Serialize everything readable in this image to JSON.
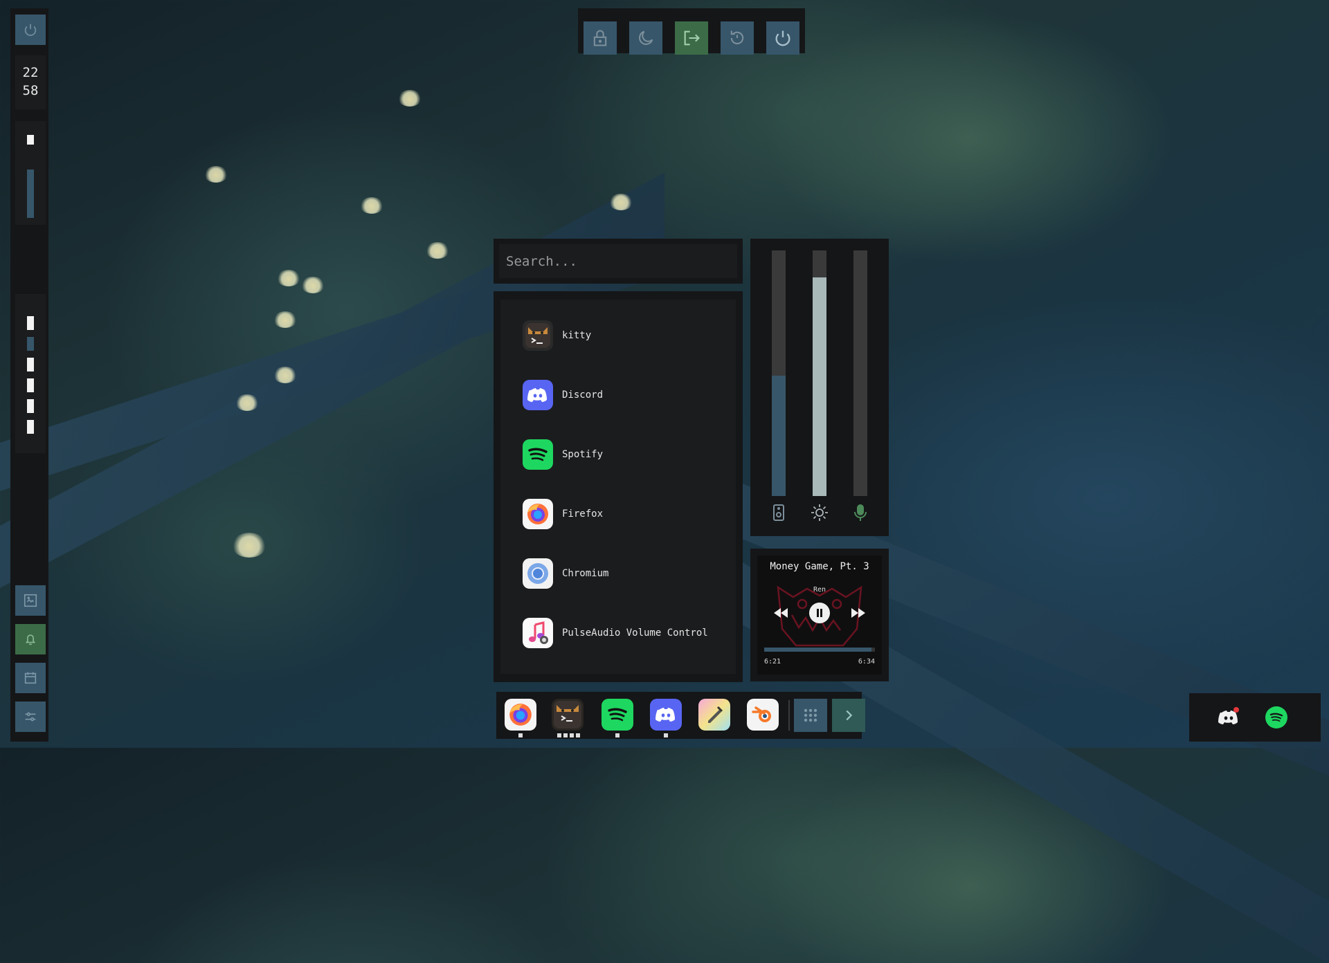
{
  "clock": {
    "hour": "22",
    "minute": "58"
  },
  "power_menu": {
    "items": [
      {
        "name": "lock",
        "icon": "lock-icon",
        "active": false
      },
      {
        "name": "suspend",
        "icon": "moon-icon",
        "active": false
      },
      {
        "name": "logout",
        "icon": "logout-icon",
        "active": true
      },
      {
        "name": "reboot",
        "icon": "reboot-icon",
        "active": false
      },
      {
        "name": "shutdown",
        "icon": "power-icon",
        "active": false
      }
    ]
  },
  "launcher": {
    "search_placeholder": "Search...",
    "apps": [
      {
        "label": "kitty",
        "icon": "kitty-icon"
      },
      {
        "label": "Discord",
        "icon": "discord-icon"
      },
      {
        "label": "Spotify",
        "icon": "spotify-icon"
      },
      {
        "label": "Firefox",
        "icon": "firefox-icon"
      },
      {
        "label": "Chromium",
        "icon": "chromium-icon"
      },
      {
        "label": "PulseAudio Volume Control",
        "icon": "pulseaudio-icon"
      }
    ]
  },
  "sliders": {
    "volume_level": 0.49,
    "brightness_level": 0.89,
    "mic_level": 0.0,
    "icons": [
      "speaker-icon",
      "sun-icon",
      "mic-icon"
    ]
  },
  "battery": {
    "level": 0.7
  },
  "media": {
    "title": "Money Game, Pt. 3",
    "artist": "Ren",
    "elapsed": "6:21",
    "total": "6:34",
    "progress": 0.97
  },
  "dock": {
    "apps": [
      {
        "name": "firefox",
        "running": true
      },
      {
        "name": "kitty",
        "running": true
      },
      {
        "name": "spotify",
        "running": true
      },
      {
        "name": "discord",
        "running": true
      },
      {
        "name": "colorpicker",
        "running": false
      },
      {
        "name": "blender",
        "running": false
      }
    ]
  },
  "colors": {
    "accent": "#37566a",
    "active_green": "#3c6c47",
    "panel": "#151618",
    "panel_inner": "#1b1c1e"
  }
}
